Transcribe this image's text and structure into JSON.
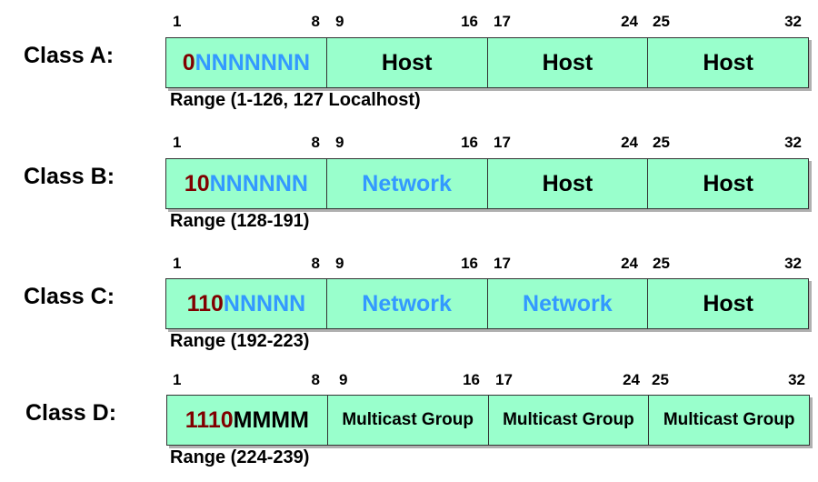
{
  "bit_labels": [
    "1",
    "8",
    "9",
    "16",
    "17",
    "24",
    "25",
    "32"
  ],
  "colors": {
    "prefix": "#800000",
    "network": "#3399ff",
    "text": "#000000",
    "cell_fill": "#99ffcc"
  },
  "classes": [
    {
      "label": "Class A:",
      "first_octet": {
        "prefix": "0",
        "rest": "NNNNNNN"
      },
      "segments": [
        "Host",
        "Host",
        "Host"
      ],
      "range": "Range (1-126, 127 Localhost)"
    },
    {
      "label": "Class B:",
      "first_octet": {
        "prefix": "10",
        "rest": "NNNNNN"
      },
      "segments": [
        "Network",
        "Host",
        "Host"
      ],
      "range": "Range (128-191)"
    },
    {
      "label": "Class C:",
      "first_octet": {
        "prefix": "110",
        "rest": "NNNNN"
      },
      "segments": [
        "Network",
        "Network",
        "Host"
      ],
      "range": "Range (192-223)"
    },
    {
      "label": "Class D:",
      "first_octet": {
        "prefix": "1110",
        "rest": "MMMM"
      },
      "segments": [
        "Multicast Group",
        "Multicast Group",
        "Multicast Group"
      ],
      "range": "Range (224-239)"
    }
  ]
}
